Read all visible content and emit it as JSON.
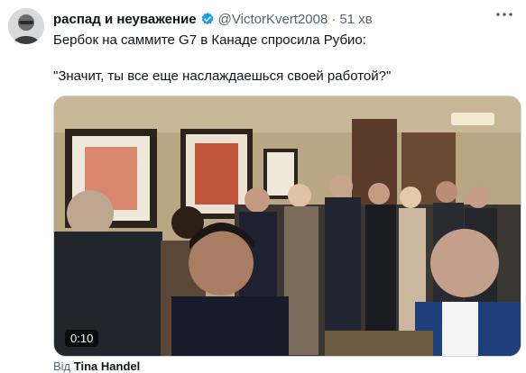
{
  "author": {
    "display_name": "распад и неуважение",
    "handle": "@VictorKvert2008",
    "separator": "·",
    "timestamp": "51 хв",
    "verified": true
  },
  "tweet": {
    "line1": "Бербок на саммите G7 в Канаде спросила  Рубио:",
    "line2": "\"Значит, ты все еще наслаждаешься своей работой?\""
  },
  "media": {
    "duration": "0:10",
    "attribution_prefix": "Від",
    "attribution_user": "Tina Handel"
  },
  "icons": {
    "more": "more-icon",
    "verified": "verified-badge-icon",
    "avatar": "avatar"
  },
  "colors": {
    "text": "#0f1419",
    "secondary": "#536471",
    "verified": "#1d9bf0"
  }
}
